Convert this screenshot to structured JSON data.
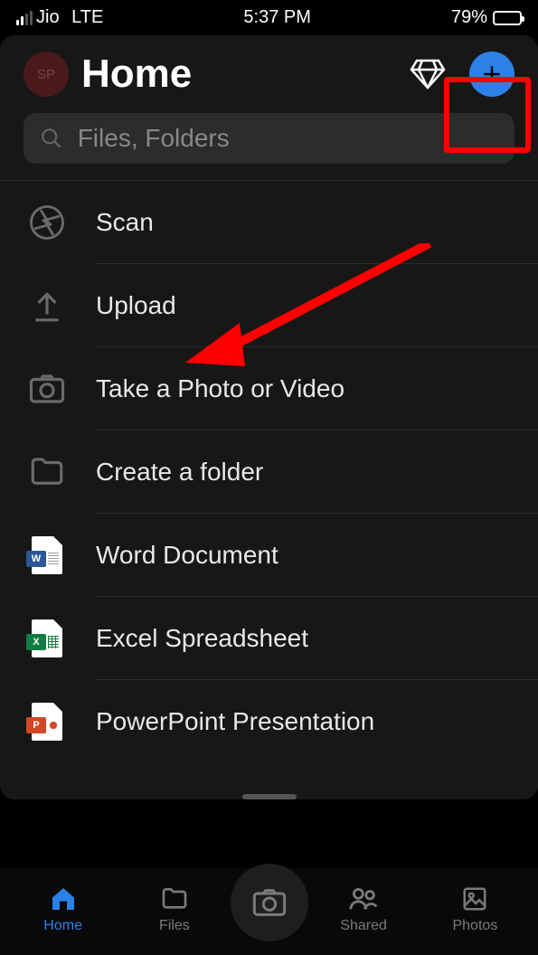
{
  "status": {
    "carrier": "Jio",
    "network": "LTE",
    "time": "5:37 PM",
    "battery_pct": "79%"
  },
  "header": {
    "avatar_initials": "SP",
    "title": "Home"
  },
  "search": {
    "placeholder": "Files, Folders"
  },
  "menu": {
    "items": [
      {
        "label": "Scan",
        "icon": "aperture-icon"
      },
      {
        "label": "Upload",
        "icon": "upload-icon"
      },
      {
        "label": "Take a Photo or Video",
        "icon": "camera-icon"
      },
      {
        "label": "Create a folder",
        "icon": "folder-icon"
      },
      {
        "label": "Word Document",
        "icon": "word-doc-icon",
        "badge": "W"
      },
      {
        "label": "Excel Spreadsheet",
        "icon": "excel-doc-icon",
        "badge": "X"
      },
      {
        "label": "PowerPoint Presentation",
        "icon": "ppt-doc-icon",
        "badge": "P"
      }
    ]
  },
  "tabs": {
    "items": [
      {
        "label": "Home",
        "active": true
      },
      {
        "label": "Files",
        "active": false
      },
      {
        "label": "Shared",
        "active": false
      },
      {
        "label": "Photos",
        "active": false
      }
    ]
  },
  "colors": {
    "accent": "#2b81e8",
    "highlight": "#ff0000",
    "background": "#000000",
    "sheet": "#171717"
  }
}
